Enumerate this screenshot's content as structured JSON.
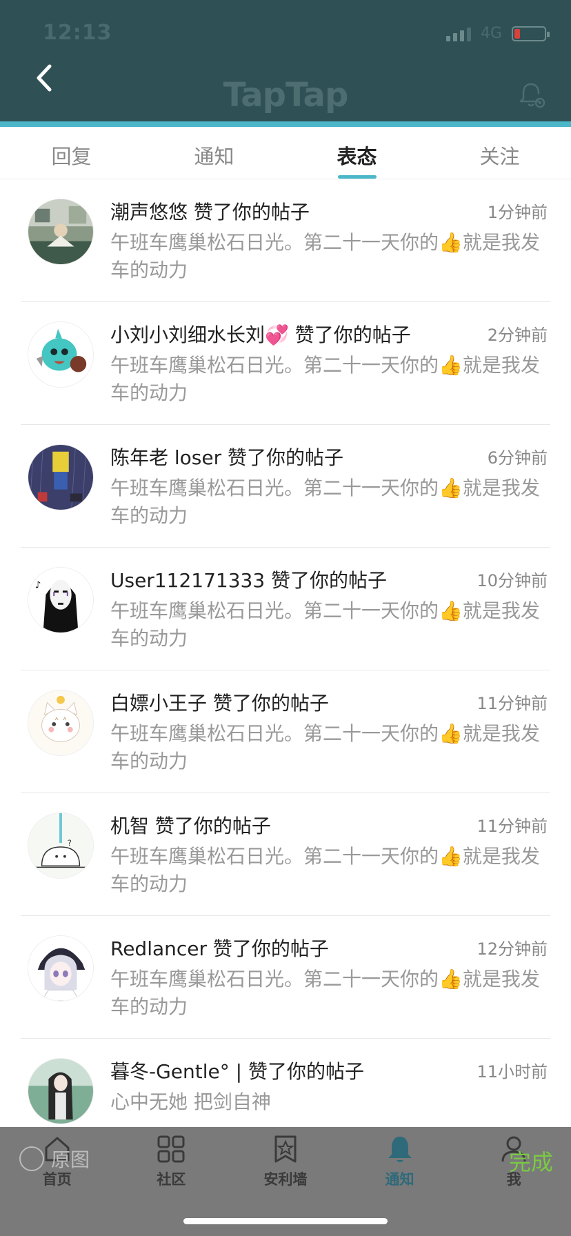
{
  "status_bar": {
    "time": "12:13",
    "network": "4G"
  },
  "header": {
    "title": "TapTap"
  },
  "tabs": [
    {
      "label": "回复"
    },
    {
      "label": "通知"
    },
    {
      "label": "表态"
    },
    {
      "label": "关注"
    }
  ],
  "notifications": [
    {
      "title": "潮声悠悠 赞了你的帖子",
      "time": "1分钟前",
      "body": "午班车鹰巢松石日光。第二十一天你的👍就是我发车的动力"
    },
    {
      "title": "小刘小刘细水长刘💞 赞了你的帖子",
      "time": "2分钟前",
      "body": "午班车鹰巢松石日光。第二十一天你的👍就是我发车的动力"
    },
    {
      "title": "陈年老 loser 赞了你的帖子",
      "time": "6分钟前",
      "body": "午班车鹰巢松石日光。第二十一天你的👍就是我发车的动力"
    },
    {
      "title": "User112171333 赞了你的帖子",
      "time": "10分钟前",
      "body": "午班车鹰巢松石日光。第二十一天你的👍就是我发车的动力"
    },
    {
      "title": "白嫖小王子 赞了你的帖子",
      "time": "11分钟前",
      "body": "午班车鹰巢松石日光。第二十一天你的👍就是我发车的动力"
    },
    {
      "title": "机智 赞了你的帖子",
      "time": "11分钟前",
      "body": "午班车鹰巢松石日光。第二十一天你的👍就是我发车的动力"
    },
    {
      "title": "Redlancer 赞了你的帖子",
      "time": "12分钟前",
      "body": "午班车鹰巢松石日光。第二十一天你的👍就是我发车的动力"
    },
    {
      "title": "暮冬-Gentle° | 赞了你的帖子",
      "time": "11小时前",
      "body": "心中无她  把剑自神"
    }
  ],
  "bottom_nav": [
    {
      "label": "首页"
    },
    {
      "label": "社区"
    },
    {
      "label": "安利墙"
    },
    {
      "label": "通知"
    },
    {
      "label": "我"
    }
  ],
  "overlay": {
    "original_label": "原图",
    "done_label": "完成"
  },
  "colors": {
    "header_bg": "#2f5155",
    "accent": "#4bb7c8",
    "done": "#7ac943"
  }
}
